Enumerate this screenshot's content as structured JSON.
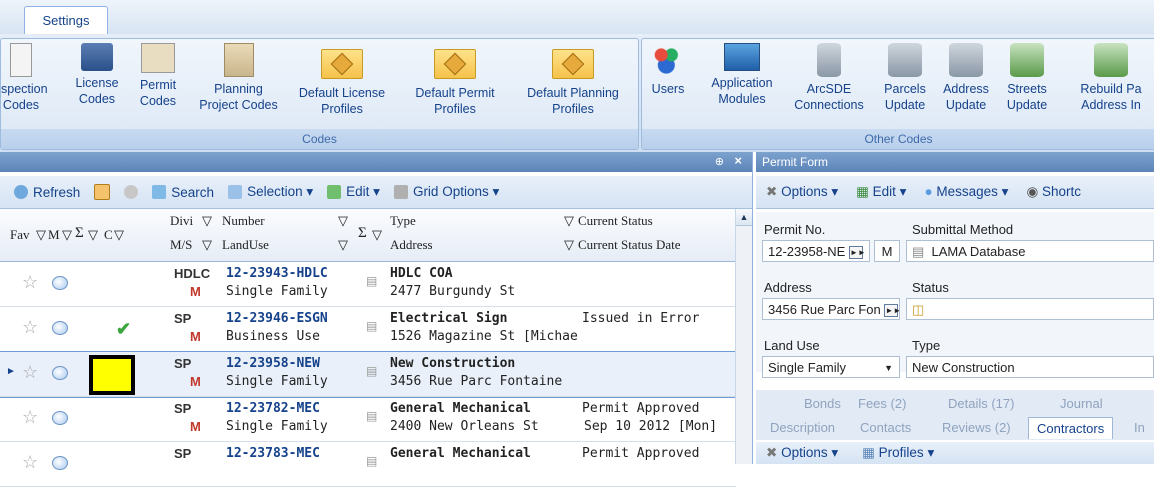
{
  "tab": "Settings",
  "ribbon": {
    "codes_group": "Codes",
    "other_group": "Other Codes",
    "codes_buttons": [
      {
        "l1": "spection",
        "l2": "Codes"
      },
      {
        "l1": "License",
        "l2": "Codes"
      },
      {
        "l1": "Permit",
        "l2": "Codes"
      },
      {
        "l1": "Planning",
        "l2": "Project Codes"
      },
      {
        "l1": "Default License",
        "l2": "Profiles"
      },
      {
        "l1": "Default Permit",
        "l2": "Profiles"
      },
      {
        "l1": "Default Planning",
        "l2": "Profiles"
      }
    ],
    "other_buttons": [
      {
        "l1": "Users",
        "l2": ""
      },
      {
        "l1": "Application",
        "l2": "Modules"
      },
      {
        "l1": "ArcSDE",
        "l2": "Connections"
      },
      {
        "l1": "Parcels",
        "l2": "Update"
      },
      {
        "l1": "Address",
        "l2": "Update"
      },
      {
        "l1": "Streets",
        "l2": "Update"
      },
      {
        "l1": "Rebuild Pa",
        "l2": "Address In"
      }
    ]
  },
  "grid_panel": {
    "pin": "⊕",
    "close": "×",
    "toolbar": {
      "refresh": "Refresh",
      "search": "Search",
      "selection": "Selection ▾",
      "edit": "Edit ▾",
      "grid_options": "Grid Options ▾"
    },
    "headers": {
      "fav": "Fav",
      "m": "M",
      "c": "C",
      "divi": "Divi",
      "ms": "M/S",
      "number": "Number",
      "landuse": "LandUse",
      "type": "Type",
      "address": "Address",
      "status": "Current Status",
      "status_date": "Current Status Date"
    },
    "rows": [
      {
        "divi": "HDLC",
        "ms": "M",
        "number": "12-23943-HDLC",
        "landuse": "Single Family",
        "type": "HDLC COA",
        "address": "2477 Burgundy St",
        "status": "",
        "date": "",
        "check": false,
        "selected": false
      },
      {
        "divi": "SP",
        "ms": "M",
        "number": "12-23946-ESGN",
        "landuse": "Business Use",
        "type": "Electrical Sign",
        "address": "1526 Magazine St [Michae",
        "status": "Issued in Error",
        "date": "",
        "check": true,
        "selected": false
      },
      {
        "divi": "SP",
        "ms": "M",
        "number": "12-23958-NEW",
        "landuse": "Single Family",
        "type": "New Construction",
        "address": "3456 Rue Parc Fontaine",
        "status": "",
        "date": "",
        "check": false,
        "selected": true
      },
      {
        "divi": "SP",
        "ms": "M",
        "number": "12-23782-MEC",
        "landuse": "Single Family",
        "type": "General Mechanical",
        "address": "2400 New Orleans St",
        "status": "Permit Approved",
        "date": "Sep 10 2012 [Mon]",
        "check": false,
        "selected": false
      },
      {
        "divi": "SP",
        "ms": "",
        "number": "12-23783-MEC",
        "landuse": "",
        "type": "General Mechanical",
        "address": "",
        "status": "Permit Approved",
        "date": "",
        "check": false,
        "selected": false
      }
    ]
  },
  "form_panel": {
    "title": "Permit Form",
    "toolbar": {
      "options": "Options ▾",
      "edit": "Edit ▾",
      "messages": "Messages ▾",
      "shortcuts": "Shortc"
    },
    "permit_no_label": "Permit No.",
    "permit_no": "12-23958-NE",
    "m_button": "M",
    "submittal_label": "Submittal Method",
    "submittal": "LAMA Database",
    "address_label": "Address",
    "address": "3456 Rue Parc Fon",
    "status_label": "Status",
    "landuse_label": "Land Use",
    "landuse": "Single Family",
    "type_label": "Type",
    "type": "New Construction",
    "tabs_row1": [
      "Bonds",
      "Fees (2)",
      "Details (17)",
      "Journal"
    ],
    "tabs_row2": [
      "Description",
      "Contacts",
      "Reviews (2)",
      "Contractors",
      "In"
    ],
    "bottom": {
      "options": "Options ▾",
      "profiles": "Profiles ▾"
    }
  },
  "colors": {
    "highlight": "#ffff00",
    "accent": "#15428b"
  }
}
